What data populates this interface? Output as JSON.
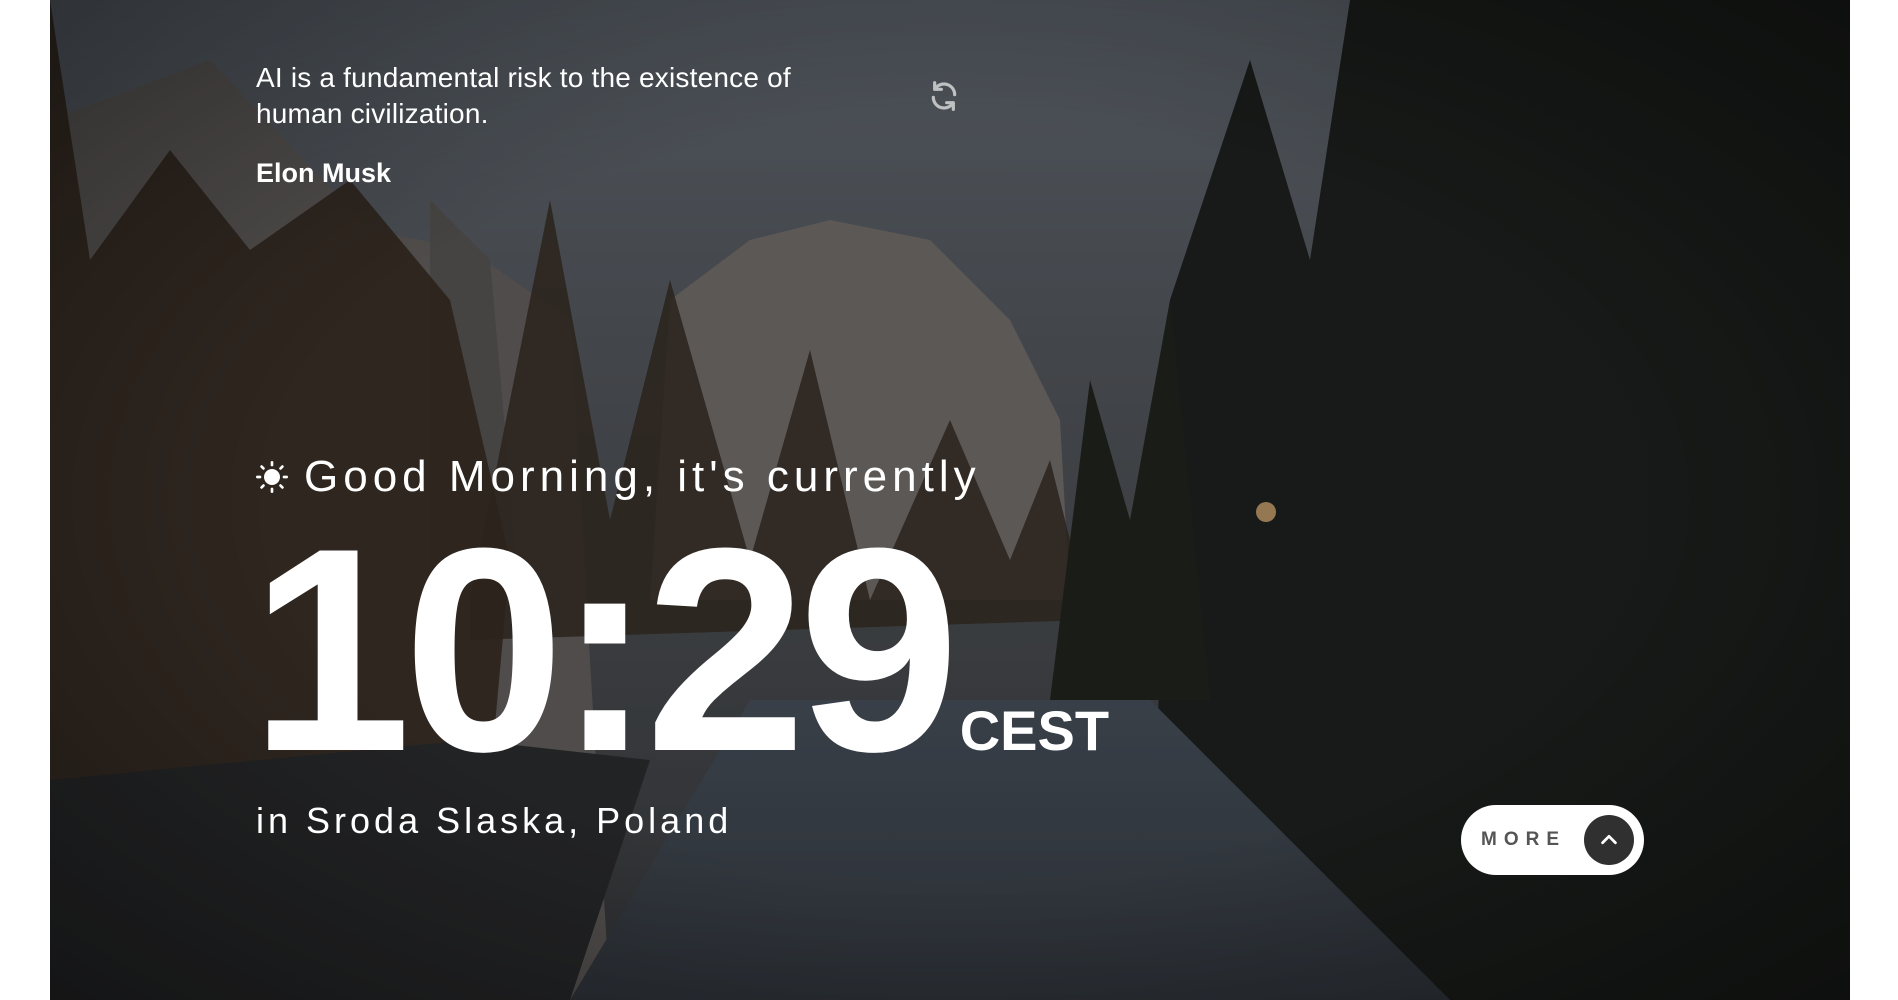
{
  "quote": {
    "text": "AI is a fundamental risk to the existence of human civilization.",
    "author": "Elon Musk"
  },
  "greeting": {
    "text": "Good Morning, it's currently",
    "icon": "sun-icon"
  },
  "clock": {
    "time": "10:29",
    "timezone": "CEST"
  },
  "location": {
    "text": "in Sroda Slaska, Poland"
  },
  "more_button": {
    "label": "MORE",
    "icon": "chevron-up-icon"
  },
  "colors": {
    "text": "#ffffff",
    "button_bg": "#ffffff",
    "button_text": "#555555",
    "arrow_bg": "#303030"
  }
}
